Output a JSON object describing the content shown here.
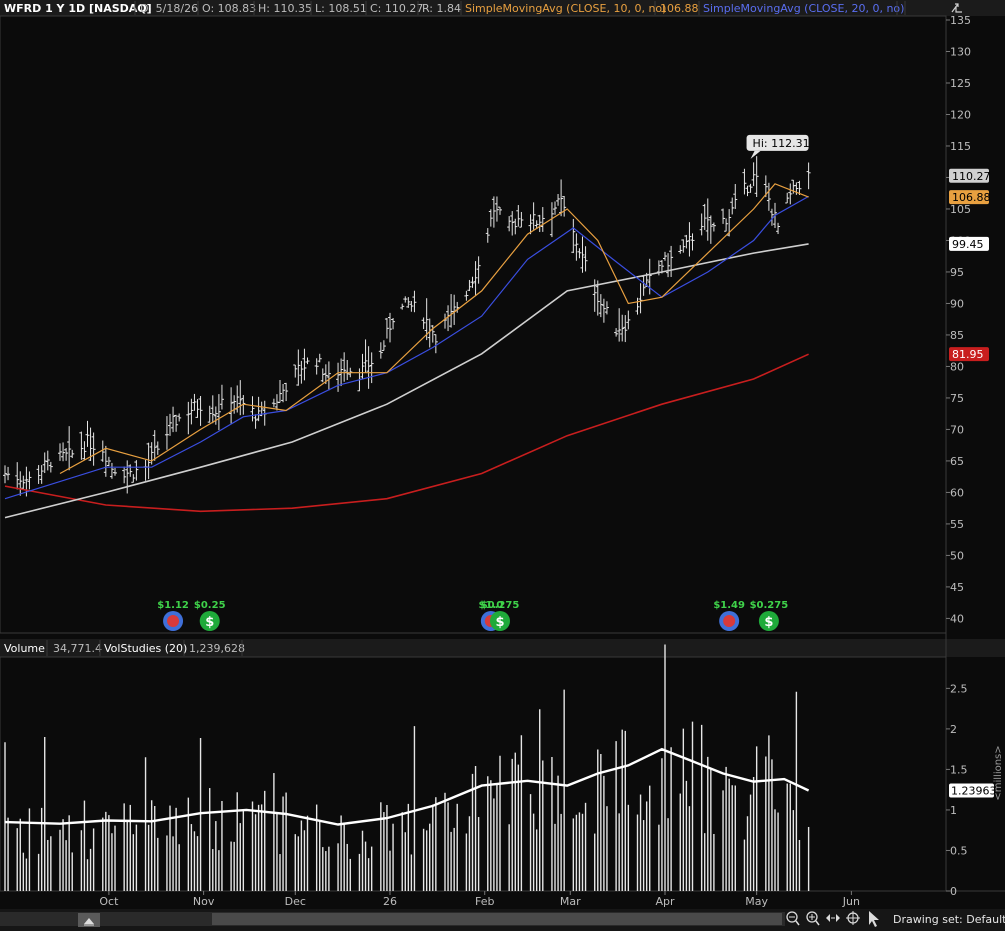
{
  "header": {
    "symbol_label": "WFRD 1 Y 1D [NASDAQ]",
    "date_label": "D: 5/18/26",
    "open_label": "O: 108.83",
    "high_label": "H: 110.35",
    "low_label": "L: 108.51",
    "close_label": "C: 110.27",
    "range_label": "R: 1.84",
    "sma10_label": "SimpleMovingAvg (CLOSE, 10, 0, no)",
    "sma10_value": "106.88",
    "sma20_label": "SimpleMovingAvg (CLOSE, 20, 0, no)",
    "sma20_value": "",
    "sma10_color": "#e8a040",
    "sma20_color": "#3a4ee0"
  },
  "volume_header": {
    "volume_label": "Volume",
    "volume_value": "34,771.4",
    "volstudies_label": "VolStudies (20)",
    "volstudies_value": "1,239,628"
  },
  "bottom_bar": {
    "drawing_set_label": "Drawing set: Default"
  },
  "icons": [
    "scroll-left-icon",
    "zoom-out-icon",
    "zoom-in-icon",
    "pan-icon",
    "crosshair-icon",
    "cursor-icon",
    "expand-icon"
  ],
  "chart_data": [
    {
      "type": "ohlc",
      "ylim": [
        38,
        135
      ],
      "yticks": [
        "40",
        "45",
        "50",
        "55",
        "60",
        "65",
        "70",
        "75",
        "80",
        "85",
        "90",
        "95",
        "100",
        "105",
        "110",
        "115",
        "120",
        "125",
        "130",
        "135"
      ],
      "x_tick_labels": [
        {
          "label": "Oct",
          "date": "2025-10-01"
        },
        {
          "label": "Nov",
          "date": "2025-11-01"
        },
        {
          "label": "Dec",
          "date": "2025-12-01"
        },
        {
          "label": "26",
          "date": "2026-01-01"
        },
        {
          "label": "Feb",
          "date": "2026-02-01"
        },
        {
          "label": "Mar",
          "date": "2026-03-01"
        },
        {
          "label": "Apr",
          "date": "2026-04-01"
        },
        {
          "label": "May",
          "date": "2026-05-01"
        },
        {
          "label": "Jun",
          "date": "2026-06-01"
        }
      ],
      "date_range": [
        "2025-08-28",
        "2026-06-30"
      ],
      "close_path": [
        [
          "2025-08-28",
          63
        ],
        [
          "2025-09-05",
          62
        ],
        [
          "2025-09-12",
          65
        ],
        [
          "2025-09-19",
          66
        ],
        [
          "2025-09-24",
          68
        ],
        [
          "2025-09-29",
          67
        ],
        [
          "2025-10-02",
          64
        ],
        [
          "2025-10-08",
          63
        ],
        [
          "2025-10-13",
          64
        ],
        [
          "2025-10-17",
          67
        ],
        [
          "2025-10-22",
          71
        ],
        [
          "2025-10-27",
          73
        ],
        [
          "2025-10-31",
          74
        ],
        [
          "2025-11-05",
          73
        ],
        [
          "2025-11-10",
          75
        ],
        [
          "2025-11-14",
          74
        ],
        [
          "2025-11-19",
          72
        ],
        [
          "2025-11-24",
          74
        ],
        [
          "2025-11-28",
          77
        ],
        [
          "2025-12-03",
          80
        ],
        [
          "2025-12-08",
          81
        ],
        [
          "2025-12-12",
          78
        ],
        [
          "2025-12-17",
          80
        ],
        [
          "2025-12-22",
          79
        ],
        [
          "2025-12-29",
          82
        ],
        [
          "2026-01-02",
          88
        ],
        [
          "2026-01-07",
          90
        ],
        [
          "2026-01-12",
          88
        ],
        [
          "2026-01-16",
          85
        ],
        [
          "2026-01-21",
          88
        ],
        [
          "2026-01-26",
          92
        ],
        [
          "2026-01-30",
          96
        ],
        [
          "2026-02-04",
          105
        ],
        [
          "2026-02-09",
          102
        ],
        [
          "2026-02-13",
          104
        ],
        [
          "2026-02-18",
          103
        ],
        [
          "2026-02-23",
          105
        ],
        [
          "2026-02-26",
          106
        ],
        [
          "2026-03-02",
          101
        ],
        [
          "2026-03-06",
          96
        ],
        [
          "2026-03-11",
          90
        ],
        [
          "2026-03-16",
          86
        ],
        [
          "2026-03-20",
          87
        ],
        [
          "2026-03-25",
          92
        ],
        [
          "2026-03-30",
          96
        ],
        [
          "2026-04-03",
          97
        ],
        [
          "2026-04-08",
          99
        ],
        [
          "2026-04-13",
          103
        ],
        [
          "2026-04-17",
          102
        ],
        [
          "2026-04-22",
          104
        ],
        [
          "2026-04-27",
          108
        ],
        [
          "2026-04-30",
          110
        ],
        [
          "2026-05-04",
          108
        ],
        [
          "2026-05-08",
          102
        ],
        [
          "2026-05-12",
          107
        ],
        [
          "2026-05-15",
          109
        ],
        [
          "2026-05-18",
          110.27
        ]
      ],
      "sma10": [
        [
          "2025-09-15",
          63
        ],
        [
          "2025-09-30",
          67
        ],
        [
          "2025-10-15",
          65
        ],
        [
          "2025-10-31",
          70
        ],
        [
          "2025-11-14",
          74
        ],
        [
          "2025-11-28",
          73
        ],
        [
          "2025-12-15",
          79
        ],
        [
          "2025-12-31",
          79
        ],
        [
          "2026-01-15",
          86
        ],
        [
          "2026-01-31",
          92
        ],
        [
          "2026-02-15",
          101
        ],
        [
          "2026-02-28",
          105
        ],
        [
          "2026-03-10",
          100
        ],
        [
          "2026-03-20",
          90
        ],
        [
          "2026-03-31",
          91
        ],
        [
          "2026-04-15",
          98
        ],
        [
          "2026-04-30",
          105
        ],
        [
          "2026-05-07",
          109
        ],
        [
          "2026-05-18",
          106.88
        ]
      ],
      "sma20": [
        [
          "2025-08-28",
          59
        ],
        [
          "2025-09-30",
          64
        ],
        [
          "2025-10-15",
          64
        ],
        [
          "2025-10-31",
          68
        ],
        [
          "2025-11-14",
          72
        ],
        [
          "2025-11-28",
          73
        ],
        [
          "2025-12-15",
          77
        ],
        [
          "2025-12-31",
          79
        ],
        [
          "2026-01-15",
          83
        ],
        [
          "2026-01-31",
          88
        ],
        [
          "2026-02-15",
          97
        ],
        [
          "2026-03-02",
          102
        ],
        [
          "2026-03-15",
          97
        ],
        [
          "2026-03-31",
          91
        ],
        [
          "2026-04-15",
          95
        ],
        [
          "2026-04-30",
          100
        ],
        [
          "2026-05-07",
          104
        ],
        [
          "2026-05-18",
          107
        ]
      ],
      "sma50": [
        [
          "2025-08-28",
          56
        ],
        [
          "2025-09-30",
          60
        ],
        [
          "2025-10-31",
          64
        ],
        [
          "2025-11-30",
          68
        ],
        [
          "2025-12-31",
          74
        ],
        [
          "2026-01-31",
          82
        ],
        [
          "2026-02-28",
          92
        ],
        [
          "2026-03-31",
          95
        ],
        [
          "2026-04-30",
          98
        ],
        [
          "2026-05-18",
          99.45
        ]
      ],
      "sma200": [
        [
          "2025-08-28",
          61
        ],
        [
          "2025-09-30",
          58
        ],
        [
          "2025-10-31",
          57
        ],
        [
          "2025-11-30",
          57.5
        ],
        [
          "2025-12-31",
          59
        ],
        [
          "2026-01-31",
          63
        ],
        [
          "2026-02-28",
          69
        ],
        [
          "2026-03-31",
          74
        ],
        [
          "2026-04-30",
          78
        ],
        [
          "2026-05-18",
          81.95
        ]
      ],
      "series": [
        {
          "line": "sma10",
          "color": "#e8a040"
        },
        {
          "line": "sma20",
          "color": "#3a4ee0"
        },
        {
          "line": "sma50",
          "color": "#cfcfcf"
        },
        {
          "line": "sma200",
          "color": "#c81e1e"
        }
      ],
      "price_labels": [
        {
          "value": 110.27,
          "text": "110.27",
          "bg": "#d0d0d0",
          "fg": "#000000"
        },
        {
          "value": 106.88,
          "text": "106.88",
          "bg": "#e8a040",
          "fg": "#000000"
        },
        {
          "value": 99.45,
          "text": "99.45",
          "bg": "#ffffff",
          "fg": "#000000"
        },
        {
          "value": 81.95,
          "text": "81.95",
          "bg": "#c81e1e",
          "fg": "#ffffff"
        }
      ],
      "annotation_high": {
        "text": "Hi: 112.31",
        "date": "2026-04-29",
        "value": 112.31
      },
      "events": [
        {
          "type": "earnings",
          "label": "$1.12",
          "date": "2025-10-22"
        },
        {
          "type": "dividend",
          "label": "$0.25",
          "date": "2025-11-03"
        },
        {
          "type": "earnings",
          "label": "$1.0",
          "date": "2026-02-03"
        },
        {
          "type": "dividend",
          "label": "$0.275",
          "date": "2026-02-06"
        },
        {
          "type": "earnings",
          "label": "$1.49",
          "date": "2026-04-22"
        },
        {
          "type": "dividend",
          "label": "$0.275",
          "date": "2026-05-05"
        }
      ],
      "event_colors": {
        "earnings": "#3f6fd8",
        "dividend": "#1faa3a",
        "label": "#3fd24a"
      }
    },
    {
      "type": "bar",
      "ylim": [
        0,
        2.85
      ],
      "yticks": [
        "0",
        "0.5",
        "1",
        "1.5",
        "2",
        "2.5"
      ],
      "ylabel": "<millions>",
      "volume_level_label": {
        "value": 1.23963,
        "text": "1.23963"
      },
      "volume_bars": [
        [
          "2025-10-26",
          1.0
        ],
        [
          "2025-10-31",
          0.9
        ],
        [
          "2025-11-06",
          0.95
        ],
        [
          "2025-11-13",
          0.8
        ],
        [
          "2025-11-20",
          0.9
        ],
        [
          "2025-11-28",
          0.85
        ],
        [
          "2025-12-05",
          1.1
        ],
        [
          "2025-12-12",
          0.9
        ],
        [
          "2025-12-19",
          1.0
        ],
        [
          "2025-12-26",
          0.9
        ],
        [
          "2026-01-01",
          1.25
        ],
        [
          "2026-01-08",
          1.1
        ],
        [
          "2026-01-16",
          1.3
        ],
        [
          "2026-01-23",
          1.45
        ],
        [
          "2026-01-30",
          1.35
        ],
        [
          "2026-02-06",
          1.2
        ],
        [
          "2026-02-13",
          1.15
        ],
        [
          "2026-02-20",
          1.3
        ],
        [
          "2026-02-27",
          1.9
        ],
        [
          "2026-03-06",
          1.7
        ],
        [
          "2026-03-13",
          1.6
        ],
        [
          "2026-03-20",
          1.8
        ],
        [
          "2026-03-27",
          1.5
        ],
        [
          "2026-04-03",
          1.4
        ],
        [
          "2026-04-10",
          1.2
        ],
        [
          "2026-04-17",
          1.5
        ],
        [
          "2026-04-24",
          1.35
        ],
        [
          "2026-05-01",
          1.2
        ],
        [
          "2026-05-08",
          1.45
        ],
        [
          "2026-05-15",
          1.1
        ],
        [
          "2026-05-18",
          0.79
        ]
      ],
      "vol_avg": [
        [
          "2025-08-28",
          0.85
        ],
        [
          "2025-09-15",
          0.83
        ],
        [
          "2025-09-30",
          0.87
        ],
        [
          "2025-10-15",
          0.86
        ],
        [
          "2025-10-31",
          0.96
        ],
        [
          "2025-11-15",
          1.0
        ],
        [
          "2025-11-28",
          0.95
        ],
        [
          "2025-12-15",
          0.82
        ],
        [
          "2025-12-31",
          0.9
        ],
        [
          "2026-01-15",
          1.05
        ],
        [
          "2026-01-31",
          1.3
        ],
        [
          "2026-02-15",
          1.36
        ],
        [
          "2026-02-28",
          1.3
        ],
        [
          "2026-03-10",
          1.45
        ],
        [
          "2026-03-20",
          1.55
        ],
        [
          "2026-03-31",
          1.75
        ],
        [
          "2026-04-10",
          1.6
        ],
        [
          "2026-04-20",
          1.45
        ],
        [
          "2026-04-30",
          1.35
        ],
        [
          "2026-05-10",
          1.38
        ],
        [
          "2026-05-18",
          1.24
        ]
      ]
    }
  ]
}
